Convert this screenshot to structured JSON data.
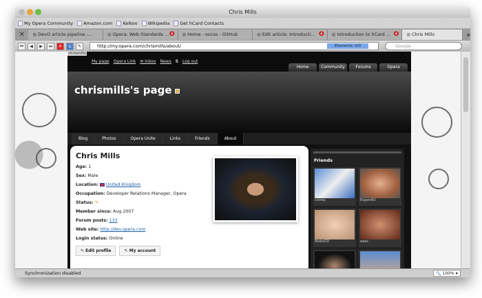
{
  "window": {
    "title": "Chris Mills"
  },
  "bookmarks": [
    "My Opera Community",
    "Amazon.com",
    "Kelkoo",
    "Wikipedia",
    "Get hCard Contacts"
  ],
  "tabs": [
    {
      "label": "DevO article pipeline -..."
    },
    {
      "label": "Opera: Web Standards ..."
    },
    {
      "label": "Home - oocss - GitHub"
    },
    {
      "label": "Edit article: Introducti..."
    },
    {
      "label": "Introduction to hCard ..."
    },
    {
      "label": "Chris Mills"
    }
  ],
  "address": {
    "url": "http://my.opera.com/chrismills/about/",
    "elements": "Elements: 0/0",
    "search_placeholder": "Google"
  },
  "site": {
    "username": "chrismills",
    "links": [
      "My page",
      "Opera Link",
      "Inbox",
      "News",
      "5",
      "Log out"
    ],
    "global_tabs": [
      "Home",
      "Community",
      "Forums",
      "Opera"
    ],
    "page_title": "chrismills's page",
    "page_tabs": [
      "Blog",
      "Photos",
      "Opera Unite",
      "Links",
      "Friends",
      "About"
    ]
  },
  "profile": {
    "name": "Chris Mills",
    "rows": [
      {
        "label": "Age:",
        "value": "1"
      },
      {
        "label": "Sex:",
        "value": "Male"
      },
      {
        "label": "Location:",
        "value": "United Kingdom",
        "link": true
      },
      {
        "label": "Occupation:",
        "value": "Developer Relations Manager, Opera"
      },
      {
        "label": "Status:",
        "value": ""
      },
      {
        "label": "Member since:",
        "value": "Aug 2007"
      },
      {
        "label": "Forum posts:",
        "value": "133",
        "link": true
      },
      {
        "label": "Web site:",
        "value": "http://dev.opera.com",
        "link": true
      },
      {
        "label": "Login status:",
        "value": "Online"
      }
    ],
    "edit_profile": "Edit profile",
    "my_account": "My account"
  },
  "friends": {
    "title": "Friends",
    "items": [
      "cstrep",
      "EspenAO",
      "AleksOD",
      "aaas",
      "",
      ""
    ]
  },
  "statusbar": {
    "text": "Synchronization disabled",
    "zoom": "100%"
  }
}
